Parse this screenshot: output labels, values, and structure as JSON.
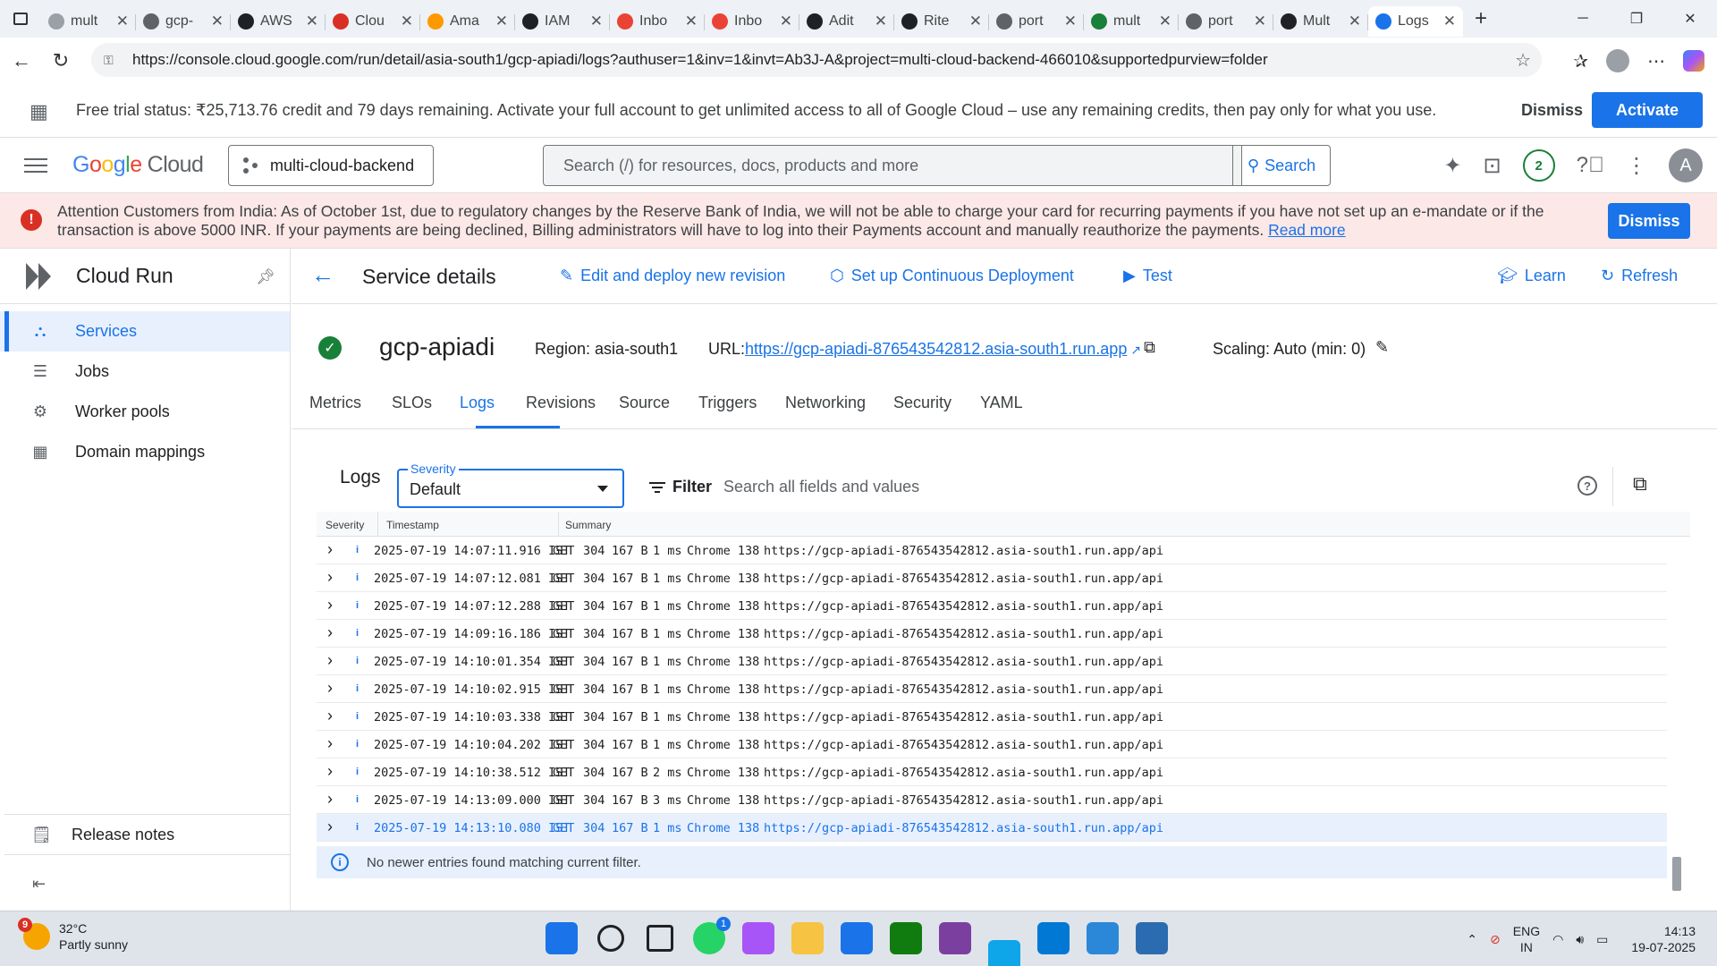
{
  "browser": {
    "tabs": [
      {
        "title": "mult",
        "color": "#9aa0a6"
      },
      {
        "title": "gcp-",
        "color": "#5f6368"
      },
      {
        "title": "AWS",
        "color": "#202124"
      },
      {
        "title": "Clou",
        "color": "#d93025"
      },
      {
        "title": "Ama",
        "color": "#ff9900"
      },
      {
        "title": "IAM",
        "color": "#202124"
      },
      {
        "title": "Inbo",
        "color": "#ea4335"
      },
      {
        "title": "Inbo",
        "color": "#ea4335"
      },
      {
        "title": "Adit",
        "color": "#202124"
      },
      {
        "title": "Rite",
        "color": "#202124"
      },
      {
        "title": "port",
        "color": "#5f6368"
      },
      {
        "title": "mult",
        "color": "#188038"
      },
      {
        "title": "port",
        "color": "#5f6368"
      },
      {
        "title": "Mult",
        "color": "#202124"
      },
      {
        "title": "Logs",
        "color": "#1a73e8"
      }
    ],
    "url": "https://console.cloud.google.com/run/detail/asia-south1/gcp-apiadi/logs?authuser=1&inv=1&invt=Ab3J-A&project=multi-cloud-backend-466010&supportedpurview=folder"
  },
  "trial": {
    "text": "Free trial status: ₹25,713.76 credit and 79 days remaining. Activate your full account to get unlimited access to all of Google Cloud – use any remaining credits, then pay only for what you use.",
    "dismiss": "Dismiss",
    "activate": "Activate"
  },
  "header": {
    "logo_google": [
      "G",
      "o",
      "o",
      "g",
      "l",
      "e"
    ],
    "logo_cloud": "Cloud",
    "project": "multi-cloud-backend",
    "search_placeholder": "Search (/) for resources, docs, products and more",
    "search_button": "Search",
    "notifications": "2",
    "account": "A"
  },
  "attention": {
    "text": "Attention Customers from India: As of October 1st, due to regulatory changes by the Reserve Bank of India, we will not be able to charge your card for recurring payments if you have not set up an e-mandate or if the transaction is above 5000 INR. If your payments are being declined, Billing administrators will have to log into their Payments account and manually reauthorize the payments.",
    "link": "Read more",
    "dismiss": "Dismiss"
  },
  "sidebar": {
    "title": "Cloud Run",
    "items": [
      {
        "label": "Services",
        "icon": "services-icon",
        "glyph": "⛬"
      },
      {
        "label": "Jobs",
        "icon": "jobs-icon",
        "glyph": "☰"
      },
      {
        "label": "Worker pools",
        "icon": "worker-pools-icon",
        "glyph": "⚙"
      },
      {
        "label": "Domain mappings",
        "icon": "domain-mappings-icon",
        "glyph": "▦"
      }
    ],
    "release_notes": "Release notes"
  },
  "service": {
    "page_title": "Service details",
    "actions": {
      "edit": "Edit and deploy new revision",
      "cd": "Set up Continuous Deployment",
      "test": "Test",
      "learn": "Learn",
      "refresh": "Refresh"
    },
    "name": "gcp-apiadi",
    "region": "Region: asia-south1",
    "url_label": "URL:",
    "url": "https://gcp-apiadi-876543542812.asia-south1.run.app",
    "scaling": "Scaling: Auto (min: 0)",
    "tabs": [
      "Metrics",
      "SLOs",
      "Logs",
      "Revisions",
      "Source",
      "Triggers",
      "Networking",
      "Security",
      "YAML"
    ],
    "active_tab": "Logs"
  },
  "logs": {
    "title": "Logs",
    "severity_label": "Severity",
    "severity_value": "Default",
    "filter": "Filter",
    "filter_placeholder": "Search all fields and values",
    "columns": [
      "Severity",
      "Timestamp",
      "Summary"
    ],
    "rows": [
      {
        "ts": "2025-07-19 14:07:11.916 IST",
        "method": "GET",
        "status": "304",
        "size": "167 B",
        "latency": "1 ms",
        "agent": "Chrome 138",
        "url": "https://gcp-apiadi-876543542812.asia-south1.run.app/api"
      },
      {
        "ts": "2025-07-19 14:07:12.081 IST",
        "method": "GET",
        "status": "304",
        "size": "167 B",
        "latency": "1 ms",
        "agent": "Chrome 138",
        "url": "https://gcp-apiadi-876543542812.asia-south1.run.app/api"
      },
      {
        "ts": "2025-07-19 14:07:12.288 IST",
        "method": "GET",
        "status": "304",
        "size": "167 B",
        "latency": "1 ms",
        "agent": "Chrome 138",
        "url": "https://gcp-apiadi-876543542812.asia-south1.run.app/api"
      },
      {
        "ts": "2025-07-19 14:09:16.186 IST",
        "method": "GET",
        "status": "304",
        "size": "167 B",
        "latency": "1 ms",
        "agent": "Chrome 138",
        "url": "https://gcp-apiadi-876543542812.asia-south1.run.app/api"
      },
      {
        "ts": "2025-07-19 14:10:01.354 IST",
        "method": "GET",
        "status": "304",
        "size": "167 B",
        "latency": "1 ms",
        "agent": "Chrome 138",
        "url": "https://gcp-apiadi-876543542812.asia-south1.run.app/api"
      },
      {
        "ts": "2025-07-19 14:10:02.915 IST",
        "method": "GET",
        "status": "304",
        "size": "167 B",
        "latency": "1 ms",
        "agent": "Chrome 138",
        "url": "https://gcp-apiadi-876543542812.asia-south1.run.app/api"
      },
      {
        "ts": "2025-07-19 14:10:03.338 IST",
        "method": "GET",
        "status": "304",
        "size": "167 B",
        "latency": "1 ms",
        "agent": "Chrome 138",
        "url": "https://gcp-apiadi-876543542812.asia-south1.run.app/api"
      },
      {
        "ts": "2025-07-19 14:10:04.202 IST",
        "method": "GET",
        "status": "304",
        "size": "167 B",
        "latency": "1 ms",
        "agent": "Chrome 138",
        "url": "https://gcp-apiadi-876543542812.asia-south1.run.app/api"
      },
      {
        "ts": "2025-07-19 14:10:38.512 IST",
        "method": "GET",
        "status": "304",
        "size": "167 B",
        "latency": "2 ms",
        "agent": "Chrome 138",
        "url": "https://gcp-apiadi-876543542812.asia-south1.run.app/api"
      },
      {
        "ts": "2025-07-19 14:13:09.000 IST",
        "method": "GET",
        "status": "304",
        "size": "167 B",
        "latency": "3 ms",
        "agent": "Chrome 138",
        "url": "https://gcp-apiadi-876543542812.asia-south1.run.app/api"
      },
      {
        "ts": "2025-07-19 14:13:10.080 IST",
        "method": "GET",
        "status": "304",
        "size": "167 B",
        "latency": "1 ms",
        "agent": "Chrome 138",
        "url": "https://gcp-apiadi-876543542812.asia-south1.run.app/api"
      }
    ],
    "no_newer": "No newer entries found matching current filter."
  },
  "taskbar": {
    "weather_badge": "9",
    "temp": "32°C",
    "condition": "Partly sunny",
    "whatsapp_badge": "1",
    "lang": "ENG",
    "region": "IN",
    "time": "14:13",
    "date": "19-07-2025",
    "apps": [
      {
        "name": "start-icon",
        "color": "#1a73e8"
      },
      {
        "name": "search-icon",
        "color": "#202124"
      },
      {
        "name": "task-view-icon",
        "color": "#202124"
      },
      {
        "name": "whatsapp-icon",
        "color": "#25d366"
      },
      {
        "name": "copilot-icon",
        "color": "#a855f7"
      },
      {
        "name": "file-explorer-icon",
        "color": "#f6c343"
      },
      {
        "name": "store-icon",
        "color": "#1a73e8"
      },
      {
        "name": "xbox-icon",
        "color": "#107c10"
      },
      {
        "name": "app-icon",
        "color": "#7b3fa0"
      },
      {
        "name": "edge-icon",
        "color": "#0ea5e9"
      },
      {
        "name": "vscode-icon",
        "color": "#0078d4"
      },
      {
        "name": "notepad-icon",
        "color": "#2b88d8"
      },
      {
        "name": "paint-icon",
        "color": "#2b6cb0"
      }
    ]
  }
}
